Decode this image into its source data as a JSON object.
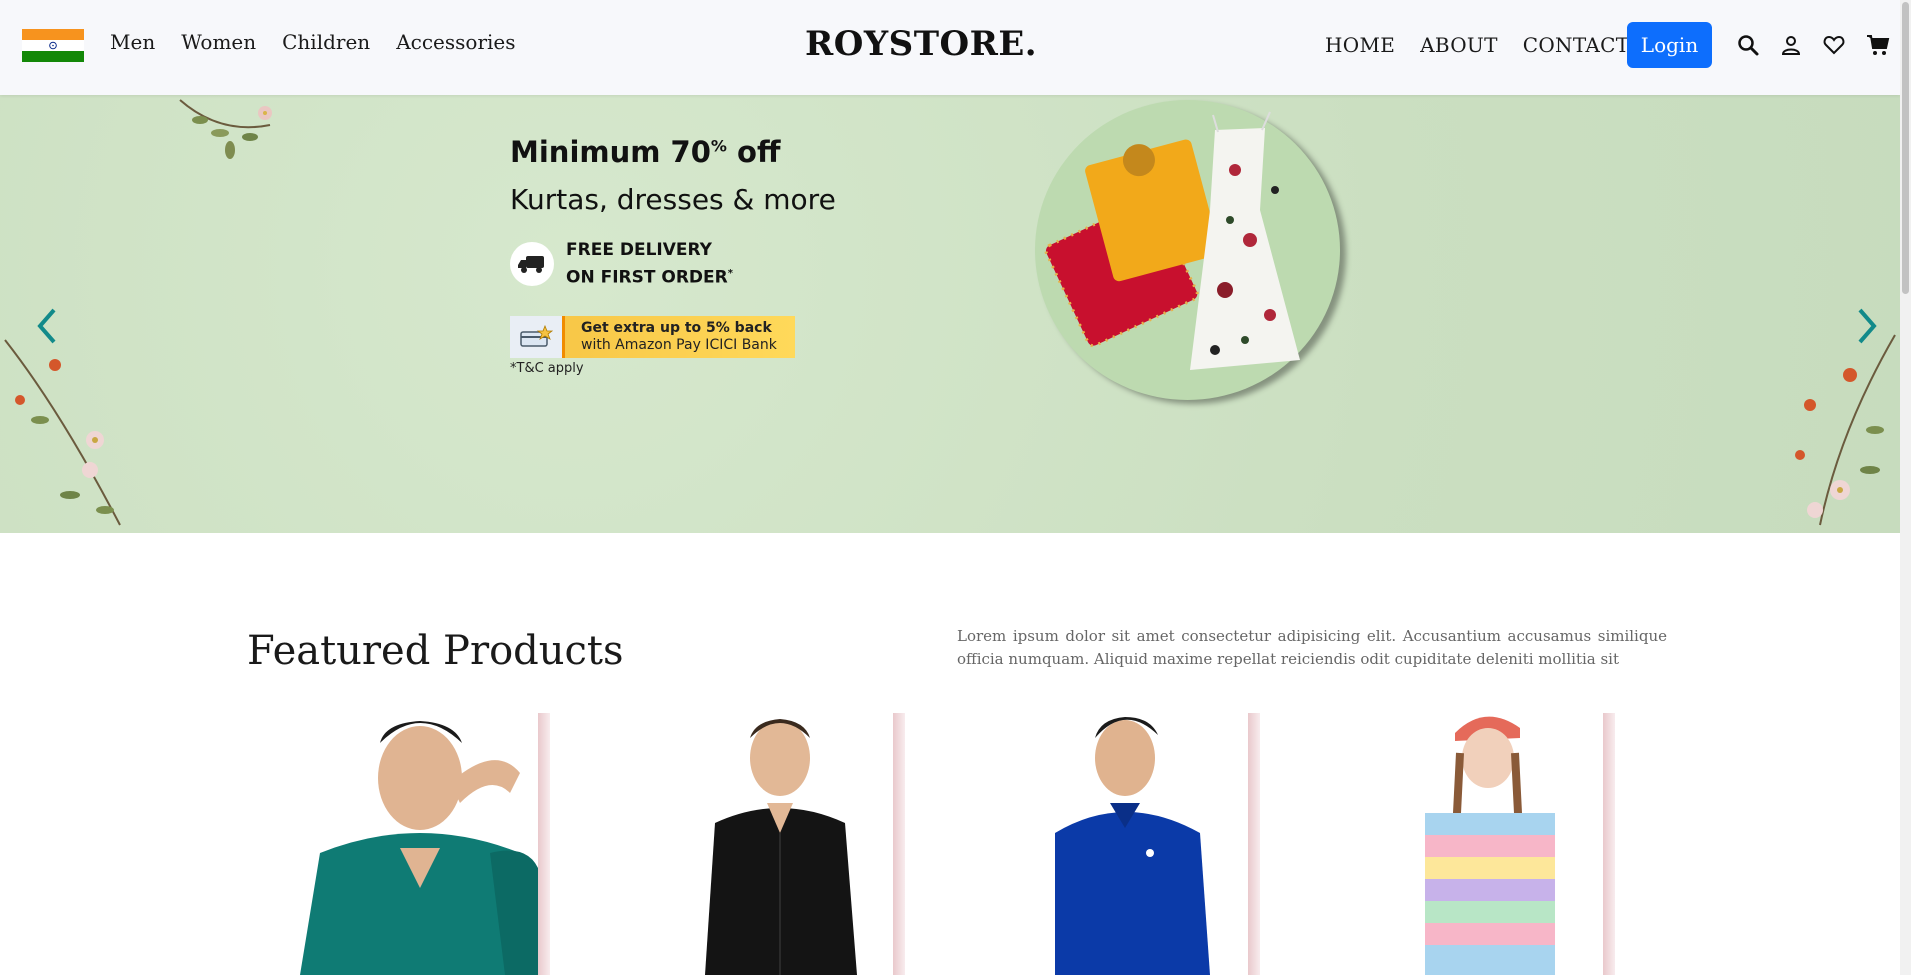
{
  "header": {
    "flag_icon": "india-flag-icon",
    "nav_left": [
      "Men",
      "Women",
      "Children",
      "Accessories"
    ],
    "brand": "ROYSTORE.",
    "nav_right": [
      "HOME",
      "ABOUT",
      "CONTACT"
    ],
    "login_label": "Login",
    "icons": [
      "search-icon",
      "user-icon",
      "heart-icon",
      "cart-icon"
    ]
  },
  "hero": {
    "title_main": "Minimum 70",
    "title_sup": "%",
    "title_end": " off",
    "subtitle": "Kurtas, dresses & more",
    "delivery_line1": "FREE DELIVERY",
    "delivery_line2": "ON FIRST ORDER",
    "delivery_mark": "*",
    "cashback_line1": "Get extra up to 5% back",
    "cashback_line2": "with Amazon Pay ICICI Bank",
    "tnc": "*T&C apply",
    "colors": {
      "background": "#cfe2c6",
      "accent": "#0d8a8a"
    }
  },
  "featured": {
    "title": "Featured Products",
    "description": "Lorem ipsum dolor sit amet consectetur adipisicing elit. Accusantium accusamus similique officia numquam. Aliquid maxime repellat reiciendis odit cupiditate deleniti mollitia sit",
    "products": [
      {
        "name": "teal-polo-shirt",
        "color": "#0f7b74"
      },
      {
        "name": "black-shirt",
        "color": "#141414"
      },
      {
        "name": "blue-polo-shirt",
        "color": "#0b3aa8"
      },
      {
        "name": "striped-dress",
        "color": "#f3b7c8"
      }
    ]
  },
  "colors": {
    "primary": "#0d6efd",
    "nav_bg": "#f7f8fb"
  }
}
